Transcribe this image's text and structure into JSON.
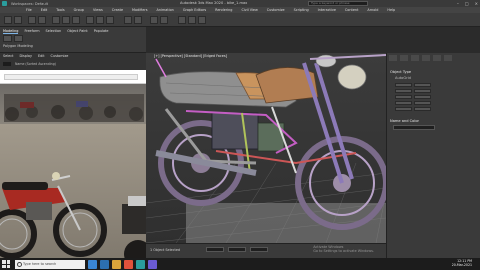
{
  "titlebar": {
    "workspace": "Workspaces: Default",
    "title": "Autodesk 3ds Max 2020 - bike_1.max",
    "search_placeholder": "Type a keyword or phrase"
  },
  "menu": [
    "File",
    "Edit",
    "Tools",
    "Group",
    "Views",
    "Create",
    "Modifiers",
    "Animation",
    "Graph Editors",
    "Rendering",
    "Civil View",
    "Customize",
    "Scripting",
    "Interactive",
    "Content",
    "Arnold",
    "Help"
  ],
  "ribbon": {
    "tabs": [
      "Modeling",
      "Freeform",
      "Selection",
      "Object Paint",
      "Populate"
    ],
    "panel_label": "Polygon Modeling"
  },
  "left_panel": {
    "tabs": [
      "Select",
      "Display",
      "Edit",
      "Customize"
    ],
    "sub": "Name (Sorted Ascending)"
  },
  "viewport": {
    "label": "[+] [Perspective] [Standard] [Edged Faces]"
  },
  "command_panel": {
    "object_type": "Object Type",
    "autogrid": "AutoGrid",
    "name_color": "Name and Color",
    "buttons": [
      "Box",
      "Cone",
      "Sphere",
      "GeoSphere",
      "Cylinder",
      "Tube",
      "Torus",
      "Pyramid",
      "Teapot",
      "Plane",
      "TextPlus"
    ]
  },
  "status": {
    "selected": "1 Object Selected",
    "watermark_title": "Activate Windows",
    "watermark_sub": "Go to Settings to activate Windows."
  },
  "taskbar": {
    "search": "Type here to search",
    "time": "12:11 PM",
    "date": "20-Mar-2021"
  },
  "colors": {
    "accent": "#7fb6e8",
    "viewport_bg": "#353535"
  }
}
